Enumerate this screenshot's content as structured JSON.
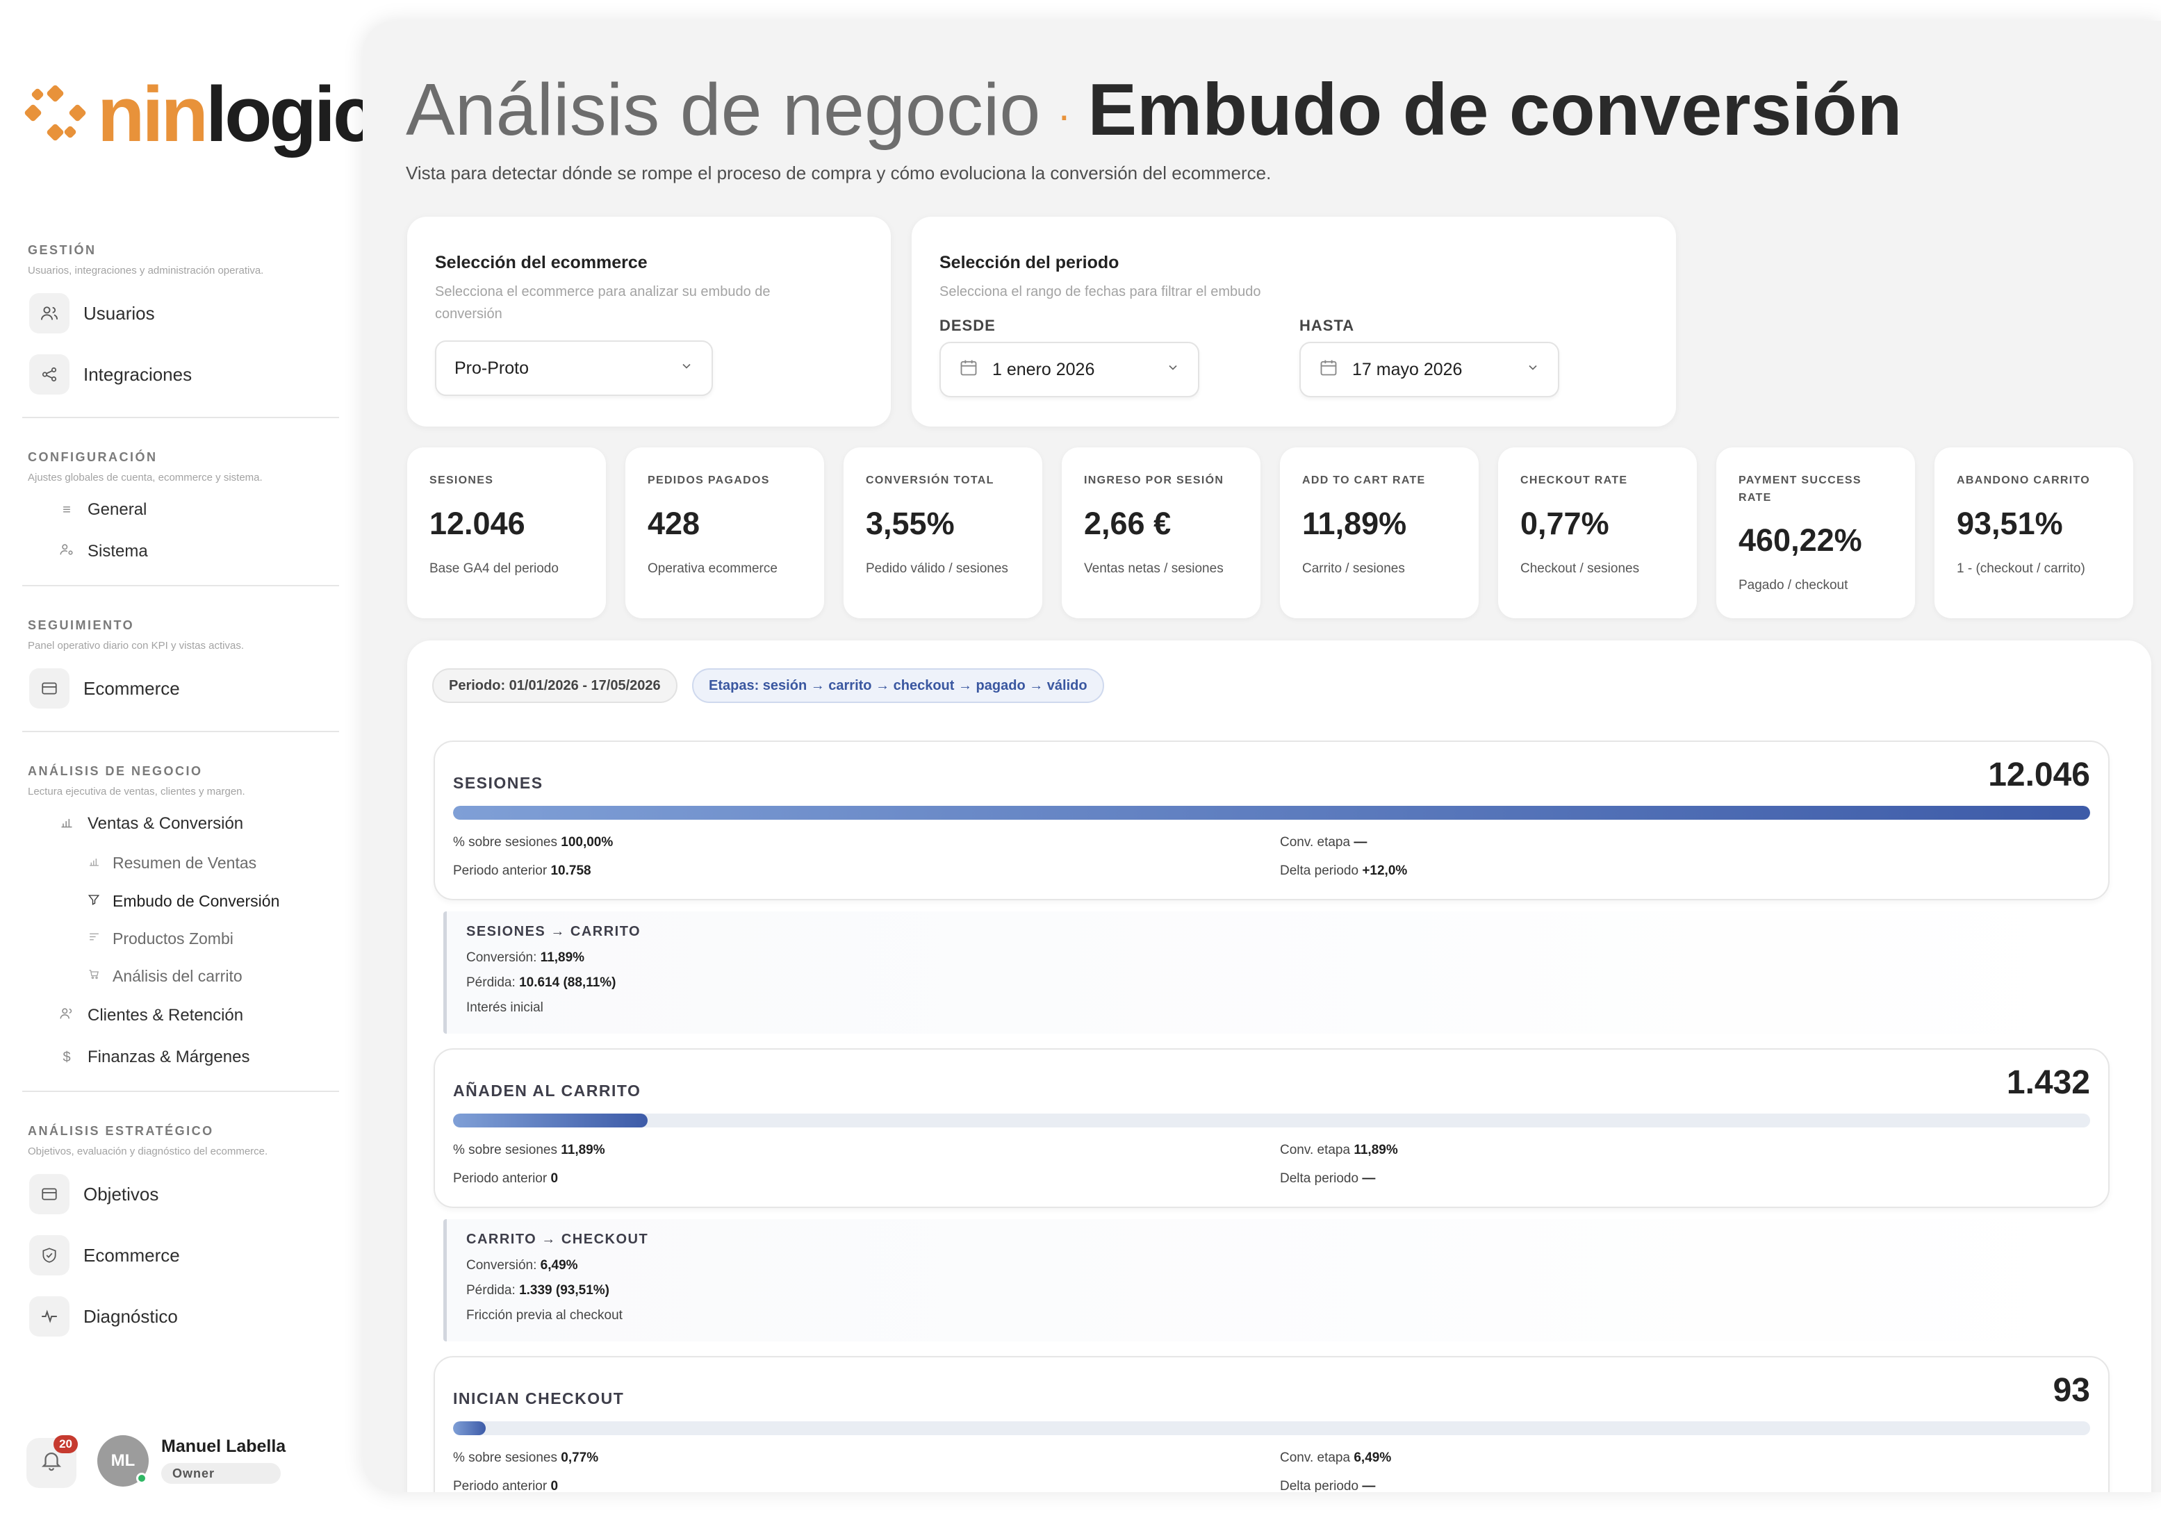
{
  "logo": {
    "part1": "nin",
    "part2": "logic"
  },
  "sidebar": {
    "gestion": {
      "title": "GESTIÓN",
      "subtitle": "Usuarios, integraciones y administración operativa.",
      "items": [
        {
          "label": "Usuarios",
          "icon": "users-icon"
        },
        {
          "label": "Integraciones",
          "icon": "share-nodes-icon"
        }
      ]
    },
    "configuracion": {
      "title": "CONFIGURACIÓN",
      "subtitle": "Ajustes globales de cuenta, ecommerce y sistema.",
      "items": [
        {
          "label": "General",
          "icon": "lines-icon"
        },
        {
          "label": "Sistema",
          "icon": "user-gear-icon"
        }
      ]
    },
    "seguimiento": {
      "title": "SEGUIMIENTO",
      "subtitle": "Panel operativo diario con KPI y vistas activas.",
      "items": [
        {
          "label": "Ecommerce",
          "icon": "card-icon"
        }
      ]
    },
    "analisis": {
      "title": "ANÁLISIS DE NEGOCIO",
      "subtitle": "Lectura ejecutiva de ventas, clientes y margen.",
      "ventas": "Ventas & Conversión",
      "ventas_items": [
        {
          "label": "Resumen de Ventas",
          "icon": "bar-chart-icon"
        },
        {
          "label": "Embudo de Conversión",
          "icon": "funnel-icon"
        },
        {
          "label": "Productos Zombi",
          "icon": "list-filter-icon"
        },
        {
          "label": "Análisis del carrito",
          "icon": "cart-icon"
        }
      ],
      "clientes": "Clientes & Retención",
      "finanzas": "Finanzas & Márgenes"
    },
    "estrategico": {
      "title": "ANÁLISIS ESTRATÉGICO",
      "subtitle": "Objetivos, evaluación y diagnóstico del ecommerce.",
      "items": [
        {
          "label": "Objetivos",
          "icon": "card-icon"
        },
        {
          "label": "Ecommerce",
          "icon": "shield-check-icon"
        },
        {
          "label": "Diagnóstico",
          "icon": "pulse-icon"
        }
      ]
    },
    "notifications": "20",
    "user": {
      "initials": "ML",
      "name": "Manuel Labella",
      "role": "Owner"
    }
  },
  "header": {
    "title_light": "Análisis de negocio",
    "title_sep": "·",
    "title_bold": "Embudo de conversión",
    "subtitle": "Vista para detectar dónde se rompe el proceso de compra y cómo evoluciona la conversión del ecommerce."
  },
  "ecommerce_card": {
    "title": "Selección del ecommerce",
    "subtitle": "Selecciona el ecommerce para analizar su embudo de conversión",
    "value": "Pro-Proto"
  },
  "period_card": {
    "title": "Selección del periodo",
    "subtitle": "Selecciona el rango de fechas para filtrar el embudo",
    "from_label": "DESDE",
    "from_value": "1 enero 2026",
    "to_label": "HASTA",
    "to_value": "17 mayo 2026"
  },
  "kpis": [
    {
      "label": "SESIONES",
      "value": "12.046",
      "sub": "Base GA4 del periodo"
    },
    {
      "label": "PEDIDOS PAGADOS",
      "value": "428",
      "sub": "Operativa ecommerce"
    },
    {
      "label": "CONVERSIÓN TOTAL",
      "value": "3,55%",
      "sub": "Pedido válido / sesiones"
    },
    {
      "label": "INGRESO POR SESIÓN",
      "value": "2,66 €",
      "sub": "Ventas netas / sesiones"
    },
    {
      "label": "ADD TO CART RATE",
      "value": "11,89%",
      "sub": "Carrito / sesiones"
    },
    {
      "label": "CHECKOUT RATE",
      "value": "0,77%",
      "sub": "Checkout / sesiones"
    },
    {
      "label": "PAYMENT SUCCESS RATE",
      "value": "460,22%",
      "sub": "Pagado / checkout"
    },
    {
      "label": "ABANDONO CARRITO",
      "value": "93,51%",
      "sub": "1 - (checkout / carrito)"
    }
  ],
  "funnel": {
    "chip_period": "Periodo: 01/01/2026 - 17/05/2026",
    "chip_stages": "Etapas: sesión → carrito → checkout → pagado → válido",
    "stages": [
      {
        "name": "SESIONES",
        "value": "12.046",
        "bar_fraction": 1.0,
        "pct_label": "% sobre sesiones",
        "pct": "100,00%",
        "conv_label": "Conv. etapa",
        "conv": "—",
        "prev_label": "Periodo anterior",
        "prev": "10.758",
        "delta_label": "Delta periodo",
        "delta": "+12,0%"
      },
      {
        "name": "AÑADEN AL CARRITO",
        "value": "1.432",
        "bar_fraction": 0.1189,
        "pct_label": "% sobre sesiones",
        "pct": "11,89%",
        "conv_label": "Conv. etapa",
        "conv": "11,89%",
        "prev_label": "Periodo anterior",
        "prev": "0",
        "delta_label": "Delta periodo",
        "delta": "—"
      },
      {
        "name": "INICIAN CHECKOUT",
        "value": "93",
        "bar_fraction": 0.0194,
        "pct_label": "% sobre sesiones",
        "pct": "0,77%",
        "conv_label": "Conv. etapa",
        "conv": "6,49%",
        "prev_label": "Periodo anterior",
        "prev": "0",
        "delta_label": "Delta periodo",
        "delta": "—"
      }
    ],
    "transitions": [
      {
        "title": "SESIONES → CARRITO",
        "conv_label": "Conversión:",
        "conv": "11,89%",
        "loss_label": "Pérdida:",
        "loss": "10.614 (88,11%)",
        "note": "Interés inicial"
      },
      {
        "title": "CARRITO → CHECKOUT",
        "conv_label": "Conversión:",
        "conv": "6,49%",
        "loss_label": "Pérdida:",
        "loss": "1.339 (93,51%)",
        "note": "Fricción previa al checkout"
      }
    ]
  }
}
